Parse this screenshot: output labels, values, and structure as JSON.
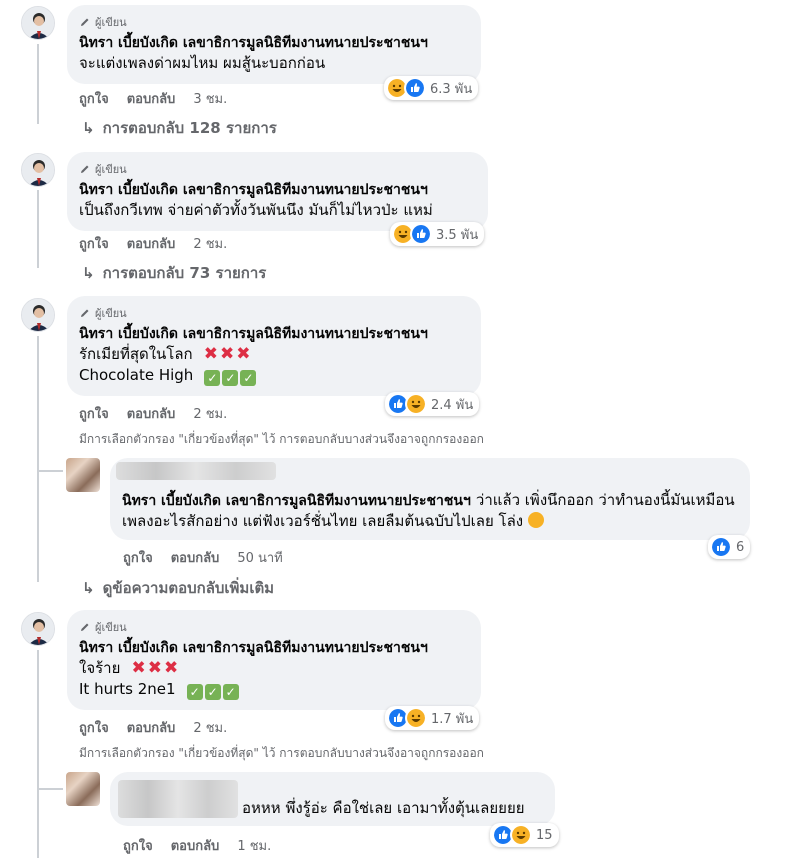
{
  "colors": {
    "like": "#1877f2",
    "haha": "#f7b125",
    "bubble": "#f0f2f5",
    "muted": "#65676b",
    "cross": "#dd2e44",
    "check": "#77b255"
  },
  "author_name": "นิทรา เบี้ยบังเกิด เลขาธิการมูลนิธิทีมงานทนายประชาชนฯ",
  "author_badge": "ผู้เขียน",
  "actions": {
    "like": "ถูกใจ",
    "reply": "ตอบกลับ"
  },
  "filter_note": "มีการเลือกตัวกรอง \"เกี่ยวข้องที่สุด\" ไว้ การตอบกลับบางส่วนจึงอาจถูกกรองออก",
  "comments": [
    {
      "text": "จะแต่งเพลงด่าผมไหม ผมสู้นะบอกก่อน",
      "time": "3 ชม.",
      "reactions": [
        "haha",
        "like"
      ],
      "reaction_count": "6.3 พัน",
      "replies_link": "การตอบกลับ 128 รายการ"
    },
    {
      "text": "เป็นถึงกวีเทพ จ่ายค่าตัวทั้งวันพันนึง มันก็ไม่ไหวป่ะ แหม่",
      "time": "2 ชม.",
      "reactions": [
        "haha",
        "like"
      ],
      "reaction_count": "3.5 พัน",
      "replies_link": "การตอบกลับ 73 รายการ"
    },
    {
      "text": "รักเมียที่สุดในโลก",
      "text2": "Chocolate High",
      "time": "2 ชม.",
      "reactions": [
        "like",
        "haha"
      ],
      "reaction_count": "2.4 พัน",
      "reply": {
        "tag_name": "นิทรา เบี้ยบังเกิด เลขาธิการมูลนิธิทีมงานทนายประชาชนฯ",
        "text": "ว่าแล้ว เพิ่งนึกออก ว่าทำนองนี้มันเหมือนเพลงอะไรสักอย่าง แต่ฟังเวอร์ชั่นไทย เลยลืมต้นฉบับไปเลย โล่ง",
        "time": "50 นาที",
        "reaction_count": "6"
      },
      "more_replies": "ดูข้อความตอบกลับเพิ่มเติม"
    },
    {
      "text": "ใจร้าย",
      "text2": "It hurts 2ne1",
      "time": "2 ชม.",
      "reactions": [
        "like",
        "haha"
      ],
      "reaction_count": "1.7 พัน",
      "reply": {
        "text": "อหหห พึ่งรู้อ่ะ คือใช่เลย เอามาทั้งตุ้นเลยยยย",
        "time": "1 ชม.",
        "reaction_count": "15"
      }
    }
  ]
}
